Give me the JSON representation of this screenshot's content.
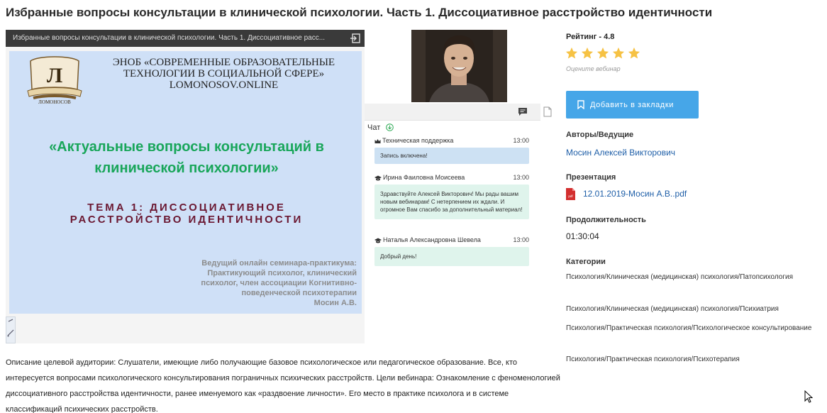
{
  "page": {
    "title": "Избранные вопросы консультации в клинической психологии. Часть 1. Диссоциативное расстройство идентичности"
  },
  "player": {
    "bar_title": "Избранные вопросы консультации в клинической психологии. Часть 1. Диссоциативное расс...",
    "exit_icon": "exit-fullscreen-icon"
  },
  "slide": {
    "logo_text": "ЛОМОНОСОВ",
    "org_line1": "ЭНОБ «СОВРЕМЕННЫЕ ОБРАЗОВАТЕЛЬНЫЕ",
    "org_line2": "ТЕХНОЛОГИИ В СОЦИАЛЬНОЙ СФЕРЕ»",
    "org_line3": "LOMONOSOV.ONLINE",
    "title": "«Актуальные вопросы консультаций в клинической психологии»",
    "topic_line1": "ТЕМА 1: ДИССОЦИАТИВНОЕ",
    "topic_line2": "РАССТРОЙСТВО ИДЕНТИЧНОСТИ",
    "lecturer_lines": [
      "Ведущий онлайн семинара-практикума:",
      "Практикующий психолог, клинический",
      "психолог, член ассоциации Когнитивно-",
      "поведенческой психотерапии",
      "Мосин А.В."
    ]
  },
  "chat": {
    "label": "Чат",
    "messages": [
      {
        "author": "Техническая поддержка",
        "time": "13:00",
        "text": "Запись включена!",
        "style": "blue"
      },
      {
        "author": "Ирина Фаиловна Моисеева",
        "time": "13:00",
        "text": "Здравствуйте Алексей Викторович! Мы рады вашим новым вебинарам! С нетерпением их ждали. И огромное Вам спасибо за дополнительный материал!",
        "style": "green"
      },
      {
        "author": "Наталья Александровна Шевела",
        "time": "13:00",
        "text": "Добрый день!",
        "style": "green"
      }
    ]
  },
  "rating": {
    "label": "Рейтинг - 4.8",
    "value": 4.8,
    "max": 5,
    "hint": "Оцените вебинар",
    "color_filled": "#f6c244",
    "color_empty": "#dfe3ea"
  },
  "bookmark": {
    "label": "Добавить в закладки",
    "color": "#46a6e8"
  },
  "authors": {
    "label": "Авторы/Ведущие",
    "name": "Мосин Алексей Викторович"
  },
  "presentation": {
    "label": "Презентация",
    "file": "12.01.2019-Мосин А.В..pdf"
  },
  "duration": {
    "label": "Продолжительность",
    "value": "01:30:04"
  },
  "categories": {
    "label": "Категории",
    "items": [
      "Психология/Клиническая (медицинская) психология/Патопсихология",
      "Психология/Клиническая (медицинская) психология/Психиатрия",
      "Психология/Практическая психология/Психологическое консультирование",
      "Психология/Практическая психология/Психотерапия"
    ]
  },
  "description": "Описание целевой аудитории: Слушатели, имеющие либо получающие базовое психологическое или педагогическое образование. Все, кто интересуется вопросами психологического консультирования пограничных психических расстройств. Цели вебинара: Ознакомление с феноменологией диссоциативного расстройства идентичности, ранее именуемого как «раздвоение личности». Его место в практике психолога и в системе классификаций психических расстройств."
}
